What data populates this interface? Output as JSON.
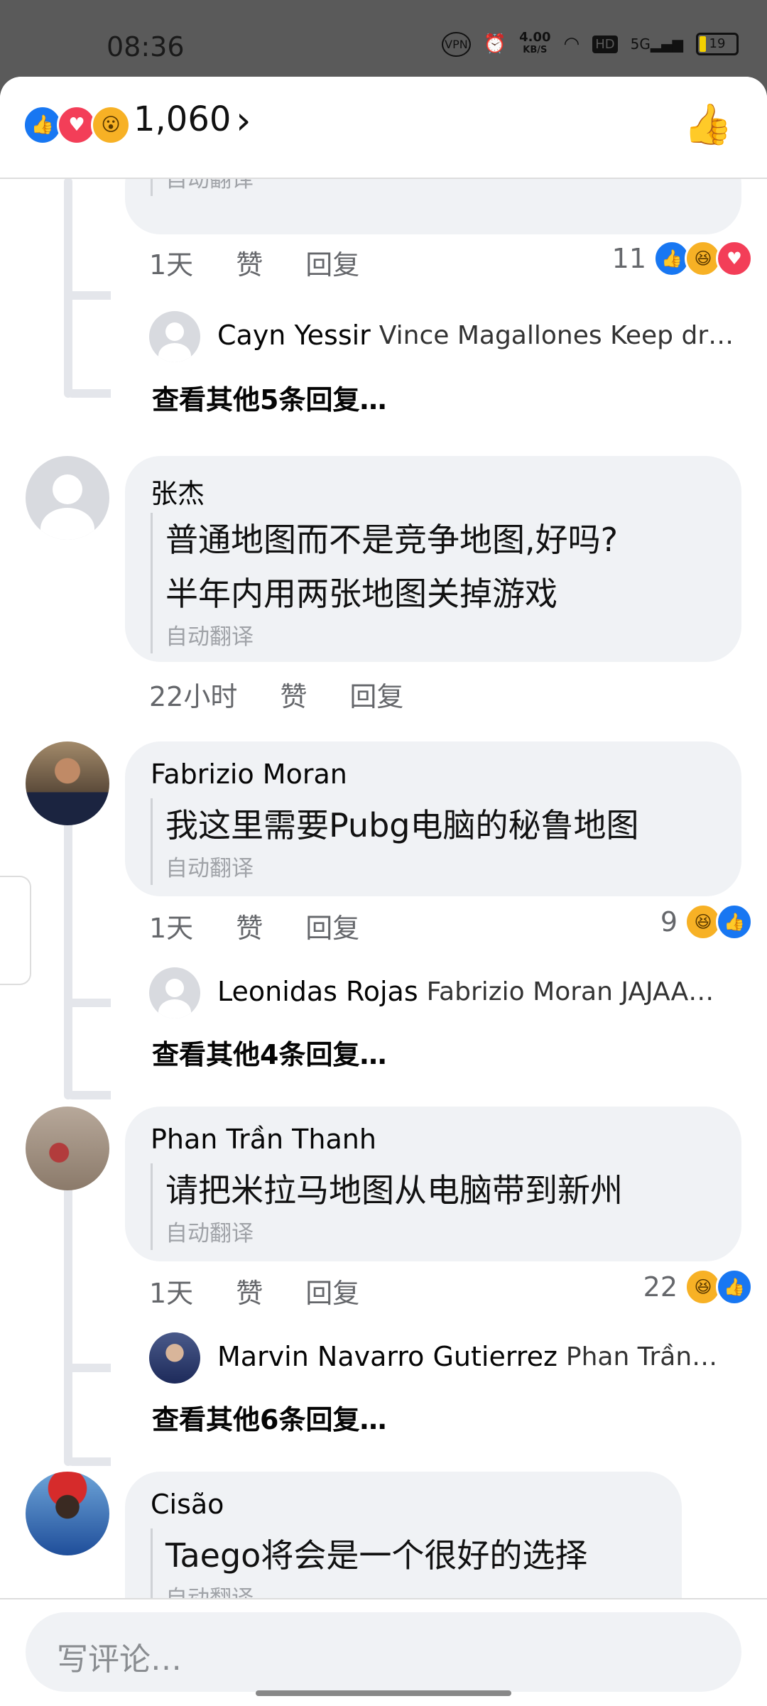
{
  "status": {
    "time": "08:36",
    "speed": "4.00",
    "speed_unit": "KB/S",
    "battery": "19",
    "net": "5G",
    "hd": "HD",
    "vpn": "VPN"
  },
  "header": {
    "count": "1,060"
  },
  "comments": [
    {
      "id": "top-partial",
      "translate": "自动翻译",
      "time": "1天",
      "like": "赞",
      "reply": "回复",
      "react_count": "11",
      "reply_preview": {
        "name": "Cayn Yessir",
        "text": "Vince Magallones Keep dr…"
      },
      "more": "查看其他5条回复…"
    },
    {
      "id": "zhang",
      "name": "张杰",
      "lines": [
        "普通地图而不是竞争地图,好吗?",
        "半年内用两张地图关掉游戏"
      ],
      "translate": "自动翻译",
      "time": "22小时",
      "like": "赞",
      "reply": "回复"
    },
    {
      "id": "fabrizio",
      "name": "Fabrizio Moran",
      "lines": [
        "我这里需要Pubg电脑的秘鲁地图"
      ],
      "translate": "自动翻译",
      "time": "1天",
      "like": "赞",
      "reply": "回复",
      "react_count": "9",
      "reply_preview": {
        "name": "Leonidas Rojas",
        "text": "Fabrizio Moran JAJAA…"
      },
      "more": "查看其他4条回复…"
    },
    {
      "id": "phan",
      "name": "Phan Trần Thanh",
      "lines": [
        "请把米拉马地图从电脑带到新州"
      ],
      "translate": "自动翻译",
      "time": "1天",
      "like": "赞",
      "reply": "回复",
      "react_count": "22",
      "reply_preview": {
        "name": "Marvin Navarro Gutierrez",
        "text": "Phan Trần…"
      },
      "more": "查看其他6条回复…"
    },
    {
      "id": "cisao",
      "name": "Cisão",
      "lines": [
        "Taego将会是一个很好的选择"
      ],
      "translate": "自动翻译"
    }
  ],
  "composer": {
    "placeholder": "写评论…"
  }
}
